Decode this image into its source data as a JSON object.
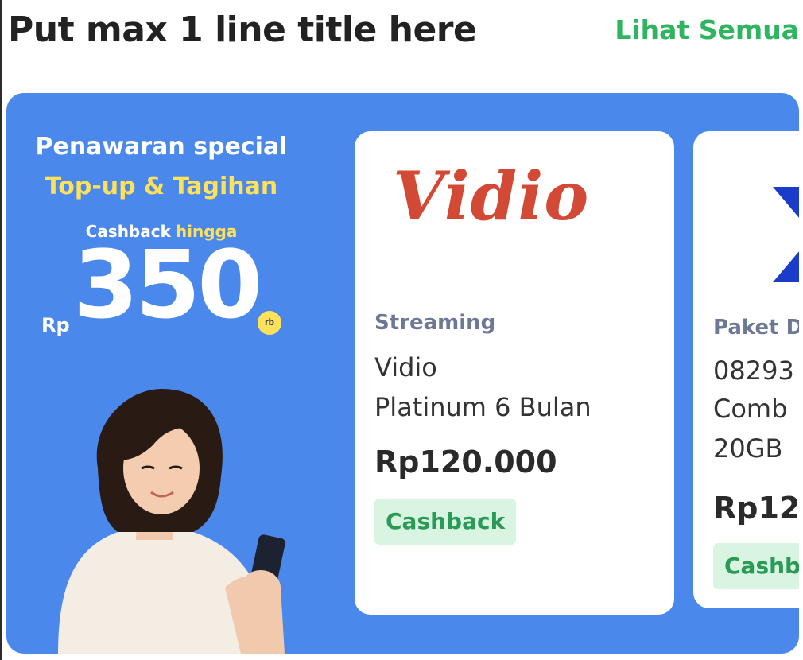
{
  "header": {
    "title": "Put max 1 line title here",
    "see_all": "Lihat Semua"
  },
  "promo": {
    "heading": "Penawaran special",
    "subheading": "Top-up & Tagihan",
    "cashback_label": "Cashback",
    "cashback_suffix": "hingga",
    "currency": "Rp",
    "amount": "350",
    "unit_badge": "rb"
  },
  "colors": {
    "banner_bg": "#4a88ec",
    "accent_green": "#2fb45f",
    "highlight_yellow": "#ffe15a",
    "vidio_red": "#d24a35"
  },
  "products": [
    {
      "logo_text": "Vidio",
      "category": "Streaming",
      "title_line1": "Vidio",
      "title_line2": "Platinum 6 Bulan",
      "price": "Rp120.000",
      "tag": "Cashback"
    },
    {
      "logo_icon": "provider-logo-icon",
      "category": "Paket D",
      "title_line1": "08293",
      "title_line2": "Comb",
      "title_line3": "20GB",
      "price": "Rp12",
      "tag": "Cashb"
    }
  ]
}
